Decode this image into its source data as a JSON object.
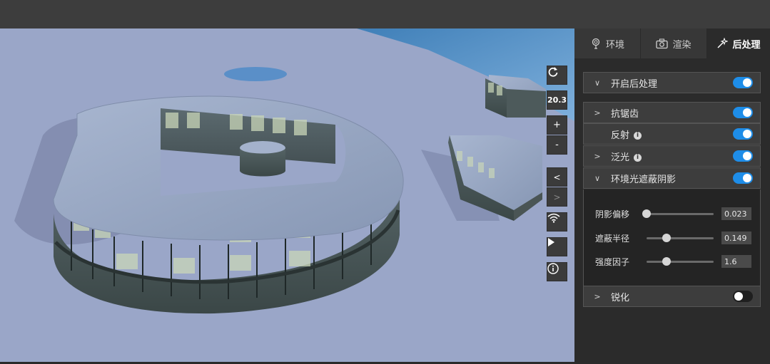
{
  "viewport": {
    "toolbar": {
      "reset_icon": "rotate-cw-icon",
      "zoom_value": "20.3",
      "zoom_in": "+",
      "zoom_out": "-",
      "prev": "<",
      "next": ">",
      "signal_icon": "wifi-icon",
      "play_icon": "play-icon",
      "info_icon": "info-icon"
    }
  },
  "panel": {
    "tabs": [
      {
        "label": "环境",
        "icon": "balloon-icon"
      },
      {
        "label": "渲染",
        "icon": "camera-icon"
      },
      {
        "label": "后处理",
        "icon": "magic-wand-icon",
        "active": true
      }
    ],
    "sections": [
      {
        "label": "开启后处理",
        "expanded": true,
        "enabled": true
      },
      {
        "label": "抗锯齿",
        "expanded": false,
        "enabled": true
      },
      {
        "label": "反射",
        "info": true,
        "enabled": true
      },
      {
        "label": "泛光",
        "info": true,
        "expanded": false,
        "enabled": true
      },
      {
        "label": "环境光遮蔽阴影",
        "expanded": true,
        "enabled": true
      },
      {
        "label": "锐化",
        "expanded": false,
        "enabled": false
      }
    ],
    "ao_params": [
      {
        "label": "阴影偏移",
        "value": "0.023",
        "fraction": 0.0
      },
      {
        "label": "遮蔽半径",
        "value": "0.149",
        "fraction": 0.3
      },
      {
        "label": "强度因子",
        "value": "1.6",
        "fraction": 0.3
      }
    ]
  },
  "colors": {
    "accent": "#1e8de8",
    "panel_bg": "#2b2b2b",
    "scene_ground": "#9aa6c8",
    "scene_water": "#5b8fc4"
  }
}
